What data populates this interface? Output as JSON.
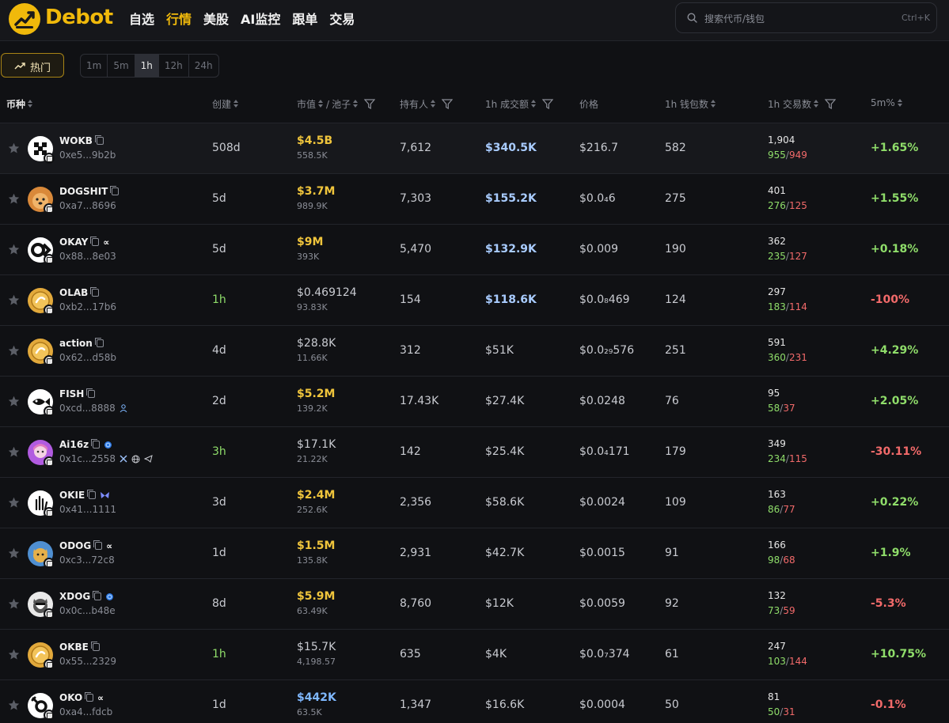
{
  "header": {
    "brand": "Debot",
    "nav": [
      "自选",
      "行情",
      "美股",
      "AI监控",
      "跟单",
      "交易"
    ],
    "active_nav": "行情",
    "search_placeholder": "搜索代币/钱包",
    "search_shortcut": "Ctrl+K"
  },
  "filters": {
    "hot_label": "热门",
    "timeframes": [
      "1m",
      "5m",
      "1h",
      "12h",
      "24h"
    ],
    "selected_timeframe": "1h"
  },
  "columns": [
    "币种",
    "创建",
    "市值",
    "池子",
    "持有人",
    "1h 成交额",
    "价格",
    "1h 钱包数",
    "1h 交易数",
    "5m%"
  ],
  "colors": {
    "accent": "#f0b90b",
    "up": "#8fdd6a",
    "down": "#f26a6a",
    "blue": "#7fb8ff"
  },
  "rows": [
    {
      "symbol": "WOKB",
      "address": "0xe5...9b2b",
      "age": "508d",
      "market_cap": "$4.5B",
      "pool": "558.5K",
      "holders": "7,612",
      "volume": "$340.5K",
      "price": "$216.7",
      "wallets": "582",
      "txns": "1,904",
      "buys": "955",
      "sells": "949",
      "change": "+1.65%",
      "avatar": "wokb-logo-icon",
      "tags": []
    },
    {
      "symbol": "DOGSHIT",
      "address": "0xa7...8696",
      "age": "5d",
      "market_cap": "$3.7M",
      "pool": "989.9K",
      "holders": "7,303",
      "volume": "$155.2K",
      "price": "$0.0₄6",
      "wallets": "275",
      "txns": "401",
      "buys": "276",
      "sells": "125",
      "change": "+1.55%",
      "avatar": "doge-avatar-icon",
      "tags": []
    },
    {
      "symbol": "OKAY",
      "address": "0x88...8e03",
      "age": "5d",
      "market_cap": "$9M",
      "pool": "393K",
      "holders": "5,470",
      "volume": "$132.9K",
      "price": "$0.009",
      "wallets": "190",
      "txns": "362",
      "buys": "235",
      "sells": "127",
      "change": "+0.18%",
      "avatar": "okay-logo-icon",
      "tags": [
        "∝"
      ]
    },
    {
      "symbol": "OLAB",
      "address": "0xb2...17b6",
      "age": "1h",
      "market_cap": "$0.469124",
      "pool": "93.83K",
      "holders": "154",
      "volume": "$118.6K",
      "price": "$0.0₈469",
      "wallets": "124",
      "txns": "297",
      "buys": "183",
      "sells": "114",
      "change": "-100%",
      "avatar": "gold-coin-icon",
      "tags": []
    },
    {
      "symbol": "action",
      "address": "0x62...d58b",
      "age": "4d",
      "market_cap": "$28.8K",
      "pool": "11.66K",
      "holders": "312",
      "volume": "$51K",
      "price": "$0.0₂₉576",
      "wallets": "251",
      "txns": "591",
      "buys": "360",
      "sells": "231",
      "change": "+4.29%",
      "avatar": "gold-coin-icon",
      "tags": []
    },
    {
      "symbol": "FISH",
      "address": "0xcd...8888",
      "age": "2d",
      "market_cap": "$5.2M",
      "pool": "139.2K",
      "holders": "17.43K",
      "volume": "$27.4K",
      "price": "$0.0248",
      "wallets": "76",
      "txns": "95",
      "buys": "58",
      "sells": "37",
      "change": "+2.05%",
      "avatar": "fish-logo-icon",
      "tags": []
    },
    {
      "symbol": "Ai16z",
      "address": "0x1c...2558",
      "age": "3h",
      "market_cap": "$17.1K",
      "pool": "21.22K",
      "holders": "142",
      "volume": "$25.4K",
      "price": "$0.0₄171",
      "wallets": "179",
      "txns": "349",
      "buys": "234",
      "sells": "115",
      "change": "-30.11%",
      "avatar": "anime-avatar-icon",
      "tags": []
    },
    {
      "symbol": "OKIE",
      "address": "0x41...1111",
      "age": "3d",
      "market_cap": "$2.4M",
      "pool": "252.6K",
      "holders": "2,356",
      "volume": "$58.6K",
      "price": "$0.0024",
      "wallets": "109",
      "txns": "163",
      "buys": "86",
      "sells": "77",
      "change": "+0.22%",
      "avatar": "hand-avatar-icon",
      "tags": []
    },
    {
      "symbol": "ODOG",
      "address": "0xc3...72c8",
      "age": "1d",
      "market_cap": "$1.5M",
      "pool": "135.8K",
      "holders": "2,931",
      "volume": "$42.7K",
      "price": "$0.0015",
      "wallets": "91",
      "txns": "166",
      "buys": "98",
      "sells": "68",
      "change": "+1.9%",
      "avatar": "dog-avatar-icon",
      "tags": [
        "∝"
      ]
    },
    {
      "symbol": "XDOG",
      "address": "0x0c...b48e",
      "age": "8d",
      "market_cap": "$5.9M",
      "pool": "63.49K",
      "holders": "8,760",
      "volume": "$12K",
      "price": "$0.0059",
      "wallets": "92",
      "txns": "132",
      "buys": "73",
      "sells": "59",
      "change": "-5.3%",
      "avatar": "husky-avatar-icon",
      "tags": []
    },
    {
      "symbol": "OKBE",
      "address": "0x55...2329",
      "age": "1h",
      "market_cap": "$15.7K",
      "pool": "4,198.57",
      "holders": "635",
      "volume": "$4K",
      "price": "$0.0₇374",
      "wallets": "61",
      "txns": "247",
      "buys": "103",
      "sells": "144",
      "change": "+10.75%",
      "avatar": "gold-coin-icon",
      "tags": []
    },
    {
      "symbol": "OKO",
      "address": "0xa4...fdcb",
      "age": "1d",
      "market_cap": "$442K",
      "pool": "63.5K",
      "holders": "1,347",
      "volume": "$16.6K",
      "price": "$0.0004",
      "wallets": "50",
      "txns": "81",
      "buys": "50",
      "sells": "31",
      "change": "-0.1%",
      "avatar": "oko-logo-icon",
      "tags": [
        "∝"
      ]
    }
  ]
}
